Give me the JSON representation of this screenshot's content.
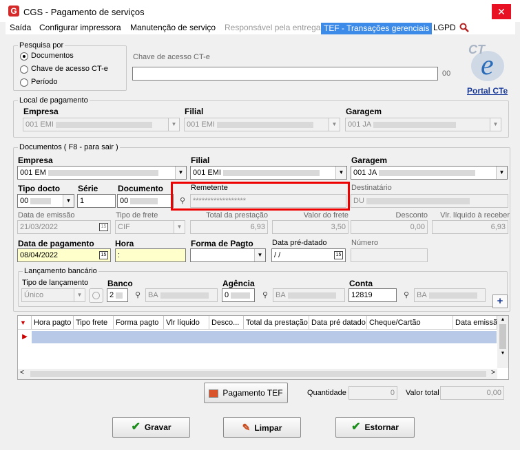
{
  "window": {
    "title": "CGS - Pagamento de serviços",
    "logo": "G",
    "close_label": "✕"
  },
  "menu": [
    "Saída",
    "Configurar impressora",
    "Manutenção de serviço",
    "Responsável pela entrega",
    "TEF - Transações gerenciais",
    "LGPD"
  ],
  "search": {
    "legend": "Pesquisa por",
    "options": [
      "Documentos",
      "Chave de acesso CT-e",
      "Período"
    ],
    "selected": "Documentos",
    "chave_label": "Chave de acesso CT-e",
    "chave_value": "",
    "chave_suffix": "00"
  },
  "portal": {
    "logo_text": "CTe",
    "link": "Portal CTe"
  },
  "local": {
    "legend": "Local de pagamento",
    "empresa_label": "Empresa",
    "empresa": "001 EMI",
    "filial_label": "Filial",
    "filial": "001 EMI",
    "garagem_label": "Garagem",
    "garagem": "001 JA"
  },
  "docs": {
    "legend": "Documentos ( F8 - para sair )",
    "empresa_label": "Empresa",
    "empresa": "001 EM",
    "filial_label": "Filial",
    "filial": "001 EMI",
    "garagem_label": "Garagem",
    "garagem": "001 JA",
    "tipo_docto_label": "Tipo docto",
    "tipo_docto": "00",
    "serie_label": "Série",
    "serie": "1",
    "documento_label": "Documento",
    "documento": "00",
    "remetente_label": "Remetente",
    "remetente": "******************",
    "destinatario_label": "Destinatário",
    "destinatario": "DU",
    "data_emissao_label": "Data de emissão",
    "data_emissao": "21/03/2022",
    "tipo_frete_label": "Tipo de frete",
    "tipo_frete": "CIF",
    "total_prestacao_label": "Total da prestação",
    "total_prestacao": "6,93",
    "valor_frete_label": "Valor do frete",
    "valor_frete": "3,50",
    "desconto_label": "Desconto",
    "desconto": "0,00",
    "liquido_label": "Vlr. líquido à receber",
    "liquido": "6,93",
    "data_pagamento_label": "Data de pagamento",
    "data_pagamento": "08/04/2022",
    "hora_label": "Hora",
    "hora": ":",
    "forma_pagto_label": "Forma de Pagto",
    "forma_pagto": "",
    "data_pre_label": "Data pré-datado",
    "data_pre": " /  /",
    "numero_label": "Número",
    "numero": ""
  },
  "lanc": {
    "legend": "Lançamento bancário",
    "tipo_label": "Tipo de lançamento",
    "tipo": "Único",
    "banco_label": "Banco",
    "banco": "2",
    "banco_nome": "BA",
    "agencia_label": "Agência",
    "agencia": "0",
    "agencia_nome": "BA",
    "conta_label": "Conta",
    "conta": "12819",
    "conta_nome": "BA",
    "add_label": "+"
  },
  "grid": {
    "columns": [
      "Hora pagto",
      "Tipo frete",
      "Forma pagto",
      "Vlr líquido",
      "Desco...",
      "Total da prestação",
      "Data pré datado",
      "Cheque/Cartão",
      "Data emissã"
    ]
  },
  "tef": {
    "button": "Pagamento TEF",
    "quantidade_label": "Quantidade",
    "quantidade": "0",
    "valor_total_label": "Valor total",
    "valor_total": "0,00"
  },
  "actions": {
    "gravar": "Gravar",
    "limpar": "Limpar",
    "estornar": "Estornar"
  }
}
